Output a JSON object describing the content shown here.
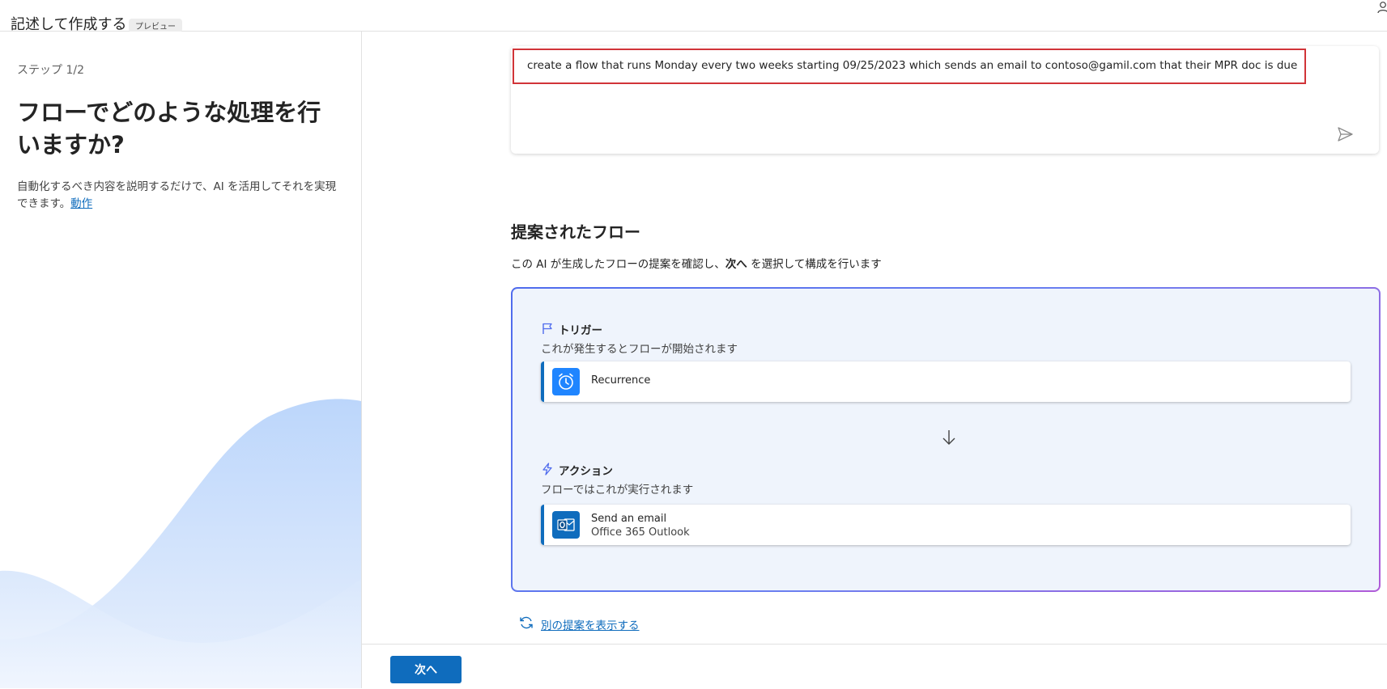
{
  "header": {
    "title": "記述して作成する",
    "preview_badge": "プレビュー"
  },
  "left_panel": {
    "step_label": "ステップ 1/2",
    "heading": "フローでどのような処理を行いますか?",
    "description": "自動化するべき内容を説明するだけで、AI を活用してそれを実現できます。",
    "learn_link": "動作"
  },
  "prompt": {
    "text": "create a flow that runs Monday every two weeks starting 09/25/2023 which sends an email to contoso@gamil.com that their MPR doc is due"
  },
  "suggested": {
    "title": "提案されたフロー",
    "desc_before": "この AI が生成したフローの提案を確認し、",
    "desc_next": "次へ",
    "desc_after": " を選択して構成を行います"
  },
  "flow": {
    "trigger": {
      "heading": "トリガー",
      "subtitle": "これが発生するとフローが開始されます",
      "operation": "Recurrence"
    },
    "action": {
      "heading": "アクション",
      "subtitle": "フローではこれが実行されます",
      "operation": "Send an email",
      "connector": "Office 365 Outlook"
    }
  },
  "refresh_link": "別の提案を表示する",
  "footer": {
    "next_label": "次へ"
  },
  "colors": {
    "accent": "#0f6cbd",
    "highlight_border": "#d13438",
    "card_bg": "#eff4fc",
    "recurrence_icon": "#1f85ff",
    "outlook_icon": "#0f6cbd"
  },
  "icons": [
    "user-icon",
    "send-icon",
    "flag-icon",
    "clock-icon",
    "arrow-down-icon",
    "lightning-icon",
    "outlook-icon",
    "refresh-icon"
  ]
}
